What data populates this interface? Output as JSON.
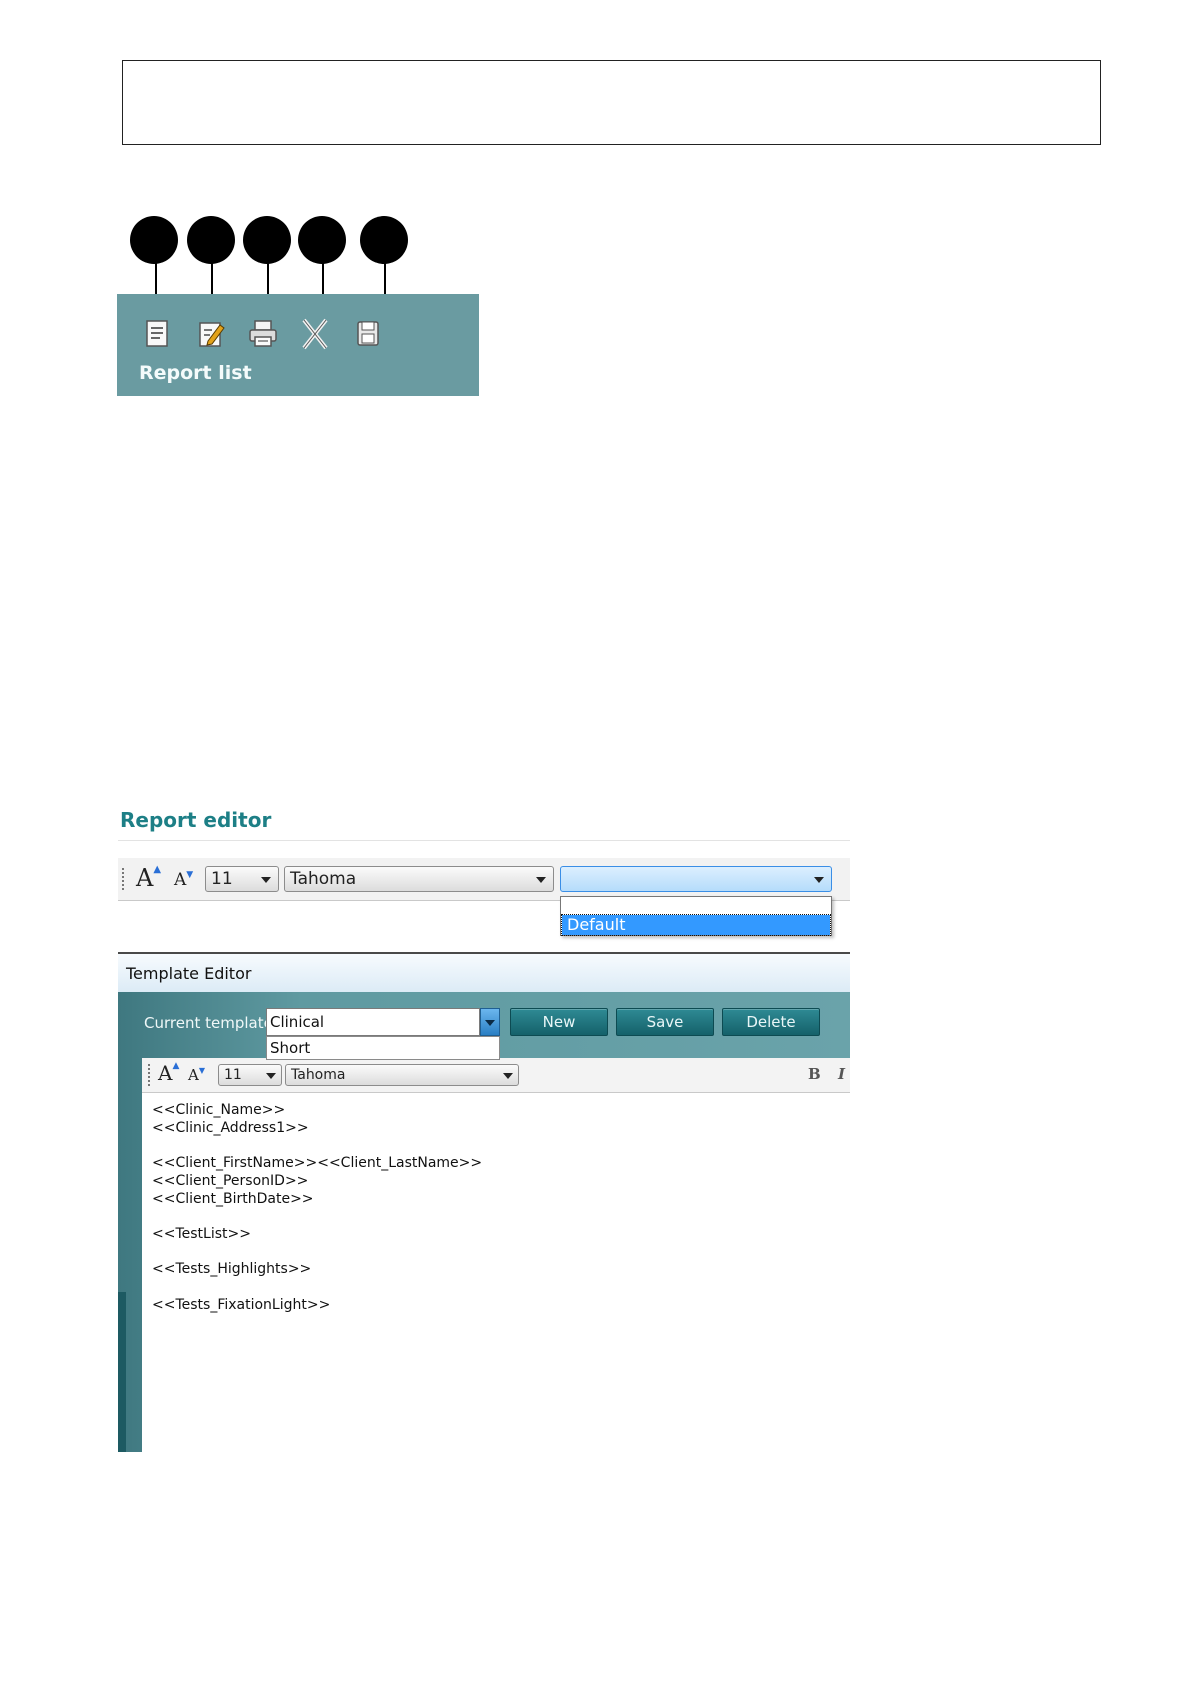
{
  "report_list": {
    "title": "Report list",
    "icons": [
      "new-report-icon",
      "edit-report-icon",
      "print-report-icon",
      "delete-report-icon",
      "save-report-icon"
    ]
  },
  "report_editor": {
    "title": "Report editor",
    "font_size": "11",
    "font_name": "Tahoma",
    "style_combo_value": "",
    "style_options": [
      "",
      "Default"
    ],
    "selected_style": "Default"
  },
  "template_editor": {
    "window_title": "Template Editor",
    "current_template_label": "Current template",
    "current_template_value": "Clinical",
    "template_options": [
      "Short"
    ],
    "buttons": {
      "new": "New",
      "save": "Save",
      "delete": "Delete"
    },
    "font_size": "11",
    "font_name": "Tahoma",
    "format_buttons": {
      "bold": "B",
      "italic": "I"
    },
    "content_lines": [
      "<<Clinic_Name>>",
      "<<Clinic_Address1>>",
      "",
      "<<Client_FirstName>><<Client_LastName>>",
      "<<Client_PersonID>>",
      "<<Client_BirthDate>>",
      "",
      "<<TestList>>",
      "",
      "<<Tests_Highlights>>",
      "",
      "<<Tests_FixationLight>>"
    ]
  },
  "colors": {
    "panel_teal": "#6a9ba1",
    "title_teal": "#1d7f86",
    "button_teal": "#15616a",
    "selection_blue": "#3399ff"
  }
}
